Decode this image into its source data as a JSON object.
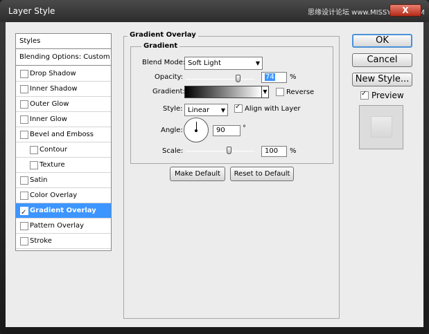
{
  "window": {
    "title": "Layer Style",
    "watermark": "思缘设计论坛  www.MISSYUAN.COM",
    "close_label": "X"
  },
  "styles_list": {
    "header": "Styles",
    "blending": "Blending Options: Custom",
    "items": [
      {
        "label": "Drop Shadow",
        "checked": false
      },
      {
        "label": "Inner Shadow",
        "checked": false
      },
      {
        "label": "Outer Glow",
        "checked": false
      },
      {
        "label": "Inner Glow",
        "checked": false
      },
      {
        "label": "Bevel and Emboss",
        "checked": false
      },
      {
        "label": "Contour",
        "checked": false
      },
      {
        "label": "Texture",
        "checked": false
      },
      {
        "label": "Satin",
        "checked": false
      },
      {
        "label": "Color Overlay",
        "checked": false
      },
      {
        "label": "Gradient Overlay",
        "checked": true
      },
      {
        "label": "Pattern Overlay",
        "checked": false
      },
      {
        "label": "Stroke",
        "checked": false
      }
    ]
  },
  "panel": {
    "group_title": "Gradient Overlay",
    "subgroup_title": "Gradient",
    "blend_mode_label": "Blend Mode:",
    "blend_mode_value": "Soft Light",
    "opacity_label": "Opacity:",
    "opacity_value": "74",
    "opacity_unit": "%",
    "gradient_label": "Gradient:",
    "reverse_label": "Reverse",
    "reverse_checked": false,
    "style_label": "Style:",
    "style_value": "Linear",
    "align_label": "Align with Layer",
    "align_checked": true,
    "angle_label": "Angle:",
    "angle_value": "90",
    "angle_unit": "°",
    "scale_label": "Scale:",
    "scale_value": "100",
    "scale_unit": "%",
    "make_default": "Make Default",
    "reset_default": "Reset to Default"
  },
  "actions": {
    "ok": "OK",
    "cancel": "Cancel",
    "new_style": "New Style...",
    "preview_label": "Preview",
    "preview_checked": true
  },
  "colors": {
    "selection": "#3d95ff",
    "dialog_bg": "#ececec",
    "title_bar": "#2c2c2c"
  }
}
